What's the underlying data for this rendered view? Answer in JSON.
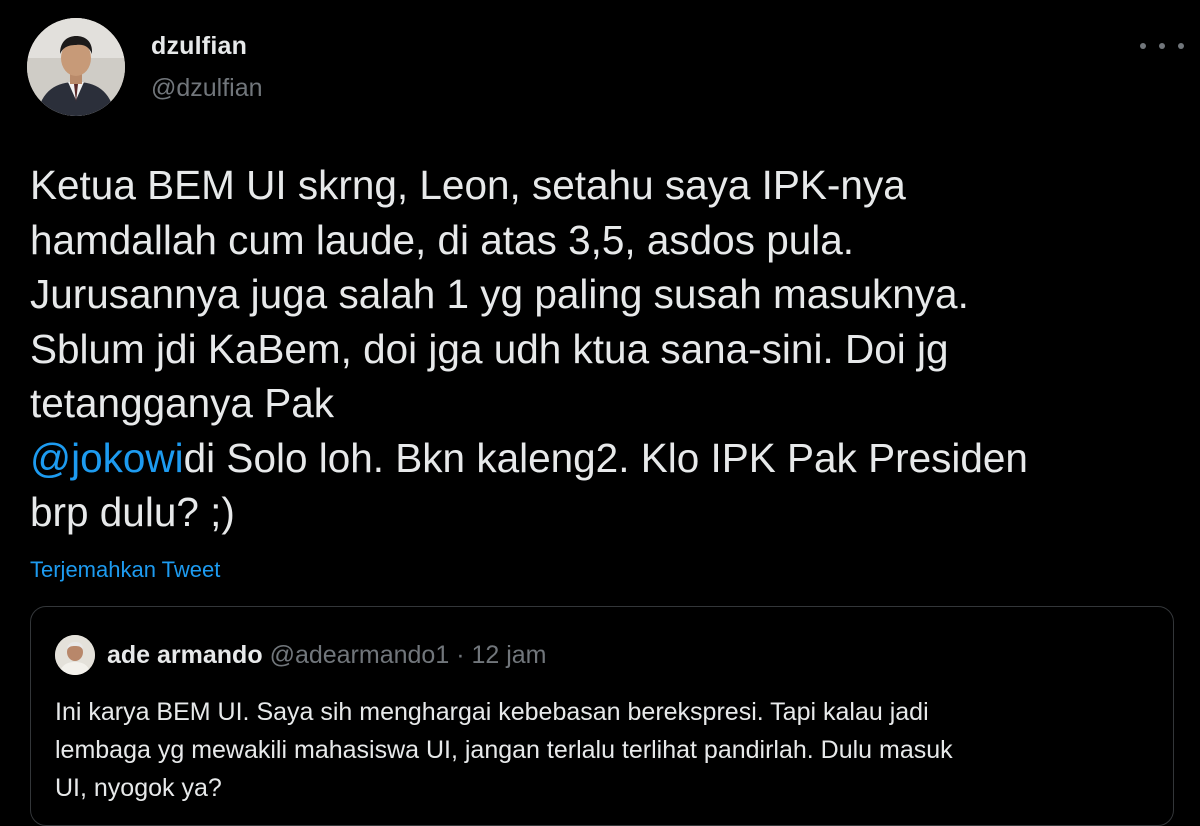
{
  "tweet": {
    "author_name": "dzulfian",
    "author_handle": "@dzulfian",
    "more_icon": "more-options-icon",
    "body": {
      "line1": "Ketua BEM UI skrng, Leon, setahu saya IPK-nya",
      "line2": "hamdallah cum laude, di atas 3,5, asdos pula.",
      "line3": "Jurusannya juga salah 1 yg paling susah masuknya.",
      "line4": "Sblum jdi KaBem, doi jga udh ktua sana-sini. Doi jg",
      "line5": "tetangganya Pak",
      "mention": "@jokowi",
      "line6_rest": "di Solo loh. Bkn kaleng2. Klo IPK Pak Presiden",
      "line7": "brp dulu? ;)"
    },
    "translate_label": "Terjemahkan Tweet"
  },
  "quoted_tweet": {
    "author_name": "ade armando",
    "author_handle": "@adearmando1",
    "separator": "·",
    "time": "12 jam",
    "line1": "Ini karya BEM UI. Saya sih menghargai kebebasan berekspresi. Tapi kalau jadi",
    "line2": "lembaga yg mewakili mahasiswa UI, jangan terlalu terlihat pandirlah. Dulu masuk",
    "line3": "UI, nyogok ya?"
  },
  "colors": {
    "background": "#000000",
    "text": "#e7e9ea",
    "secondary": "#71767b",
    "accent": "#1d9bf0",
    "border": "#333639"
  }
}
